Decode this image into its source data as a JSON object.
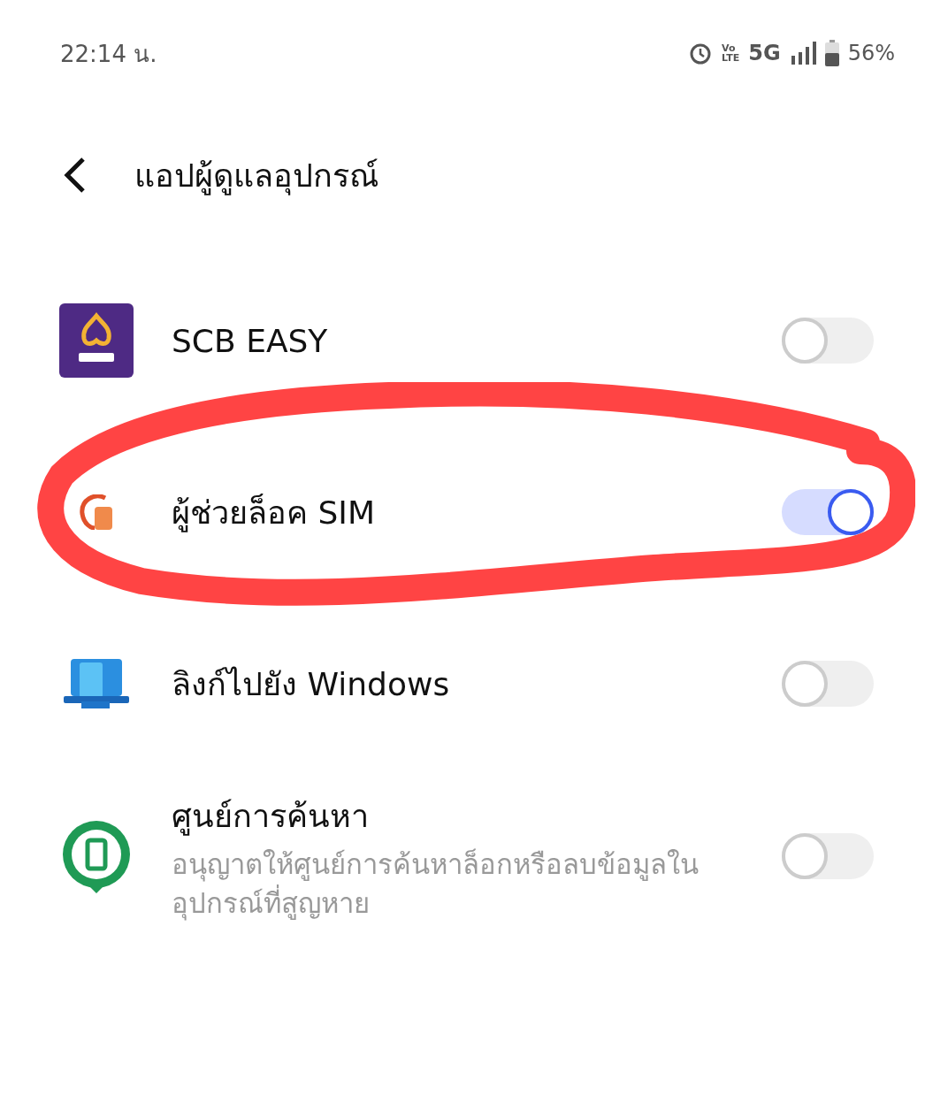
{
  "status_bar": {
    "time": "22:14 น.",
    "volte_badge": [
      "Vo",
      "LTE"
    ],
    "network": "5G",
    "battery": "56%"
  },
  "header": {
    "title": "แอปผู้ดูแลอุปกรณ์"
  },
  "apps": [
    {
      "title": "SCB EASY",
      "on": false,
      "circled": false
    },
    {
      "title": "ผู้ช่วยล็อค SIM",
      "on": true,
      "circled": true
    },
    {
      "title": "ลิงก์ไปยัง Windows",
      "on": false,
      "circled": false
    },
    {
      "title": "ศูนย์การค้นหา",
      "subtitle": "อนุญาตให้ศูนย์การค้นหาล็อกหรือลบข้อมูลในอุปกรณ์ที่สูญหาย",
      "on": false,
      "circled": false
    }
  ]
}
